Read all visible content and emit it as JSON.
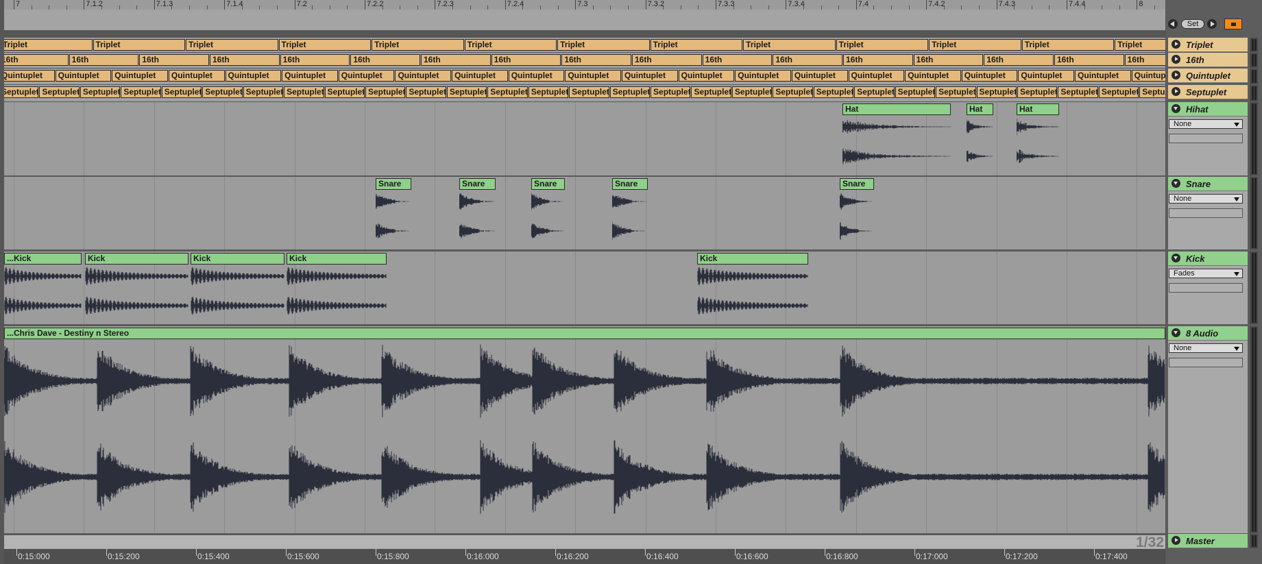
{
  "ruler": {
    "beats": [
      "7",
      "7.1.2",
      "7.1.3",
      "7.1.4",
      "7.2",
      "7.2.2",
      "7.2.3",
      "7.2.4",
      "7.3",
      "7.3.2",
      "7.3.3",
      "7.3.4",
      "7.4",
      "7.4.2",
      "7.4.3",
      "7.4.4",
      "8"
    ]
  },
  "locators": {
    "set_label": "Set"
  },
  "groove_tracks": [
    {
      "name": "Triplet",
      "clip_label": "Triplet",
      "clip_count": 13
    },
    {
      "name": "16th",
      "clip_label": "16th",
      "clip_count": 17
    },
    {
      "name": "Quintuplet",
      "clip_label": "Quintuplet",
      "clip_count": 21
    },
    {
      "name": "Septuplet",
      "clip_label": "Septuplet",
      "clip_count": 29
    }
  ],
  "audio_tracks": [
    {
      "name": "Hihat",
      "device": "None",
      "clips": [
        {
          "label": "Hat"
        },
        {
          "label": "Hat"
        },
        {
          "label": "Hat"
        }
      ]
    },
    {
      "name": "Snare",
      "device": "None",
      "clips": [
        {
          "label": "Snare"
        },
        {
          "label": "Snare"
        },
        {
          "label": "Snare"
        },
        {
          "label": "Snare"
        },
        {
          "label": "Snare"
        }
      ]
    },
    {
      "name": "Kick",
      "device": "Fades",
      "clips": [
        {
          "label": "...Kick"
        },
        {
          "label": "Kick"
        },
        {
          "label": "Kick"
        },
        {
          "label": "Kick"
        },
        {
          "label": "Kick"
        }
      ]
    },
    {
      "name": "8 Audio",
      "device": "None",
      "clips": [
        {
          "label": "...Chris Dave - Destiny n Stereo"
        }
      ]
    }
  ],
  "master": {
    "name": "Master",
    "zoom": "1/32"
  },
  "time_ruler": [
    "0:15:000",
    "0:15:200",
    "0:15:400",
    "0:15:600",
    "0:15:800",
    "0:16:000",
    "0:16:200",
    "0:16:400",
    "0:16:600",
    "0:16:800",
    "0:17:000",
    "0:17:200",
    "0:17:400"
  ],
  "colors": {
    "groove_clip": "#e4b97b",
    "audio_clip": "#8fd08a",
    "waveform": "#2b2f3b"
  }
}
